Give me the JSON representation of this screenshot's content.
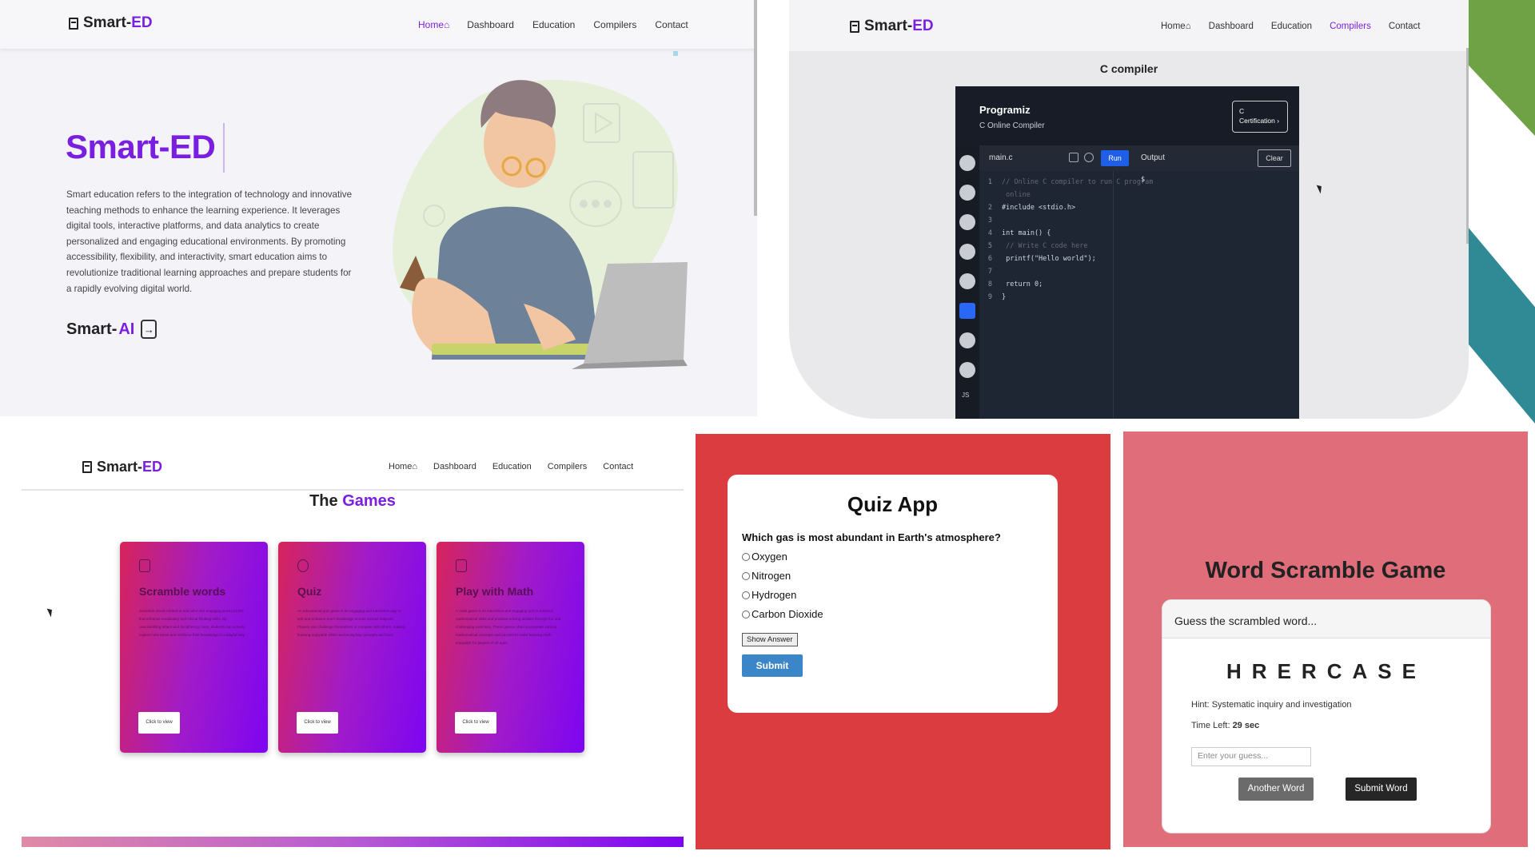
{
  "home": {
    "brand": {
      "left": "Smart-",
      "right": "ED"
    },
    "nav": [
      "Home",
      "Dashboard",
      "Education",
      "Compilers",
      "Contact"
    ],
    "hero_title": "Smart-ED",
    "description": "Smart education refers to the integration of technology and innovative teaching methods to enhance the learning experience. It leverages digital tools, interactive platforms, and data analytics to create personalized and engaging educational environments. By promoting accessibility, flexibility, and interactivity, smart education aims to revolutionize traditional learning approaches and prepare students for a rapidly evolving digital world.",
    "smart_ai": {
      "left": "Smart-",
      "right": "AI"
    }
  },
  "compiler": {
    "brand": {
      "left": "Smart-",
      "right": "ED"
    },
    "nav": [
      "Home",
      "Dashboard",
      "Education",
      "Compilers",
      "Contact"
    ],
    "active_nav": "Compilers",
    "title": "C compiler",
    "ide_brand": "Programiz",
    "ide_subtitle": "C Online Compiler",
    "cert_button": "C Certification",
    "file_tab": "main.c",
    "run_label": "Run",
    "output_label": "Output",
    "clear_label": "Clear",
    "output_prompt": "$",
    "code_lines": [
      {
        "n": "1",
        "t": "// Online C compiler to run C program"
      },
      {
        "n": "",
        "t": "   online"
      },
      {
        "n": "2",
        "t": "#include <stdio.h>"
      },
      {
        "n": "3",
        "t": ""
      },
      {
        "n": "4",
        "t": "int main() {"
      },
      {
        "n": "5",
        "t": "    // Write C code here"
      },
      {
        "n": "6",
        "t": "    printf(\"Hello world\");"
      },
      {
        "n": "7",
        "t": ""
      },
      {
        "n": "8",
        "t": "    return 0;"
      },
      {
        "n": "9",
        "t": "}"
      }
    ],
    "language_icons": [
      "python-icon",
      "r-icon",
      "sql-icon",
      "html-icon",
      "java-icon",
      "c-icon",
      "cpp-icon",
      "csharp-icon",
      "js-icon"
    ],
    "js_label": "JS"
  },
  "games": {
    "brand": {
      "left": "Smart-",
      "right": "ED"
    },
    "nav": [
      "Home",
      "Dashboard",
      "Education",
      "Compilers",
      "Contact"
    ],
    "title_left": "The",
    "title_right": "Games",
    "cards": [
      {
        "title": "Scramble words",
        "text": "Scramble words related to education are engaging word puzzles that enhance vocabulary and critical thinking skills. By unscrambling letters and deciphering clues, students can actively explore new terms and reinforce their knowledge in a playful way.",
        "button": "Click to view",
        "icon": "pencil-icon"
      },
      {
        "title": "Quiz",
        "text": "An educational quiz game is an engaging and interactive way to test and enhance one's knowledge across various subjects. Players can challenge themselves or compete with others, making learning enjoyable while reinforcing key concepts and facts.",
        "button": "Click to view",
        "icon": "question-icon"
      },
      {
        "title": "Play with Math",
        "text": "A math game is an interactive and engaging tool to enhance mathematical skills and problem-solving abilities through fun and challenging exercises. These games often incorporate various mathematical concepts and puzzles to make learning math enjoyable for players of all ages.",
        "button": "Click to view",
        "icon": "gamepad-icon"
      }
    ]
  },
  "quiz": {
    "title": "Quiz App",
    "question": "Which gas is most abundant in Earth's atmosphere?",
    "options": [
      "Oxygen",
      "Nitrogen",
      "Hydrogen",
      "Carbon Dioxide"
    ],
    "show_answer": "Show Answer",
    "submit": "Submit"
  },
  "scramble": {
    "title": "Word Scramble Game",
    "header": "Guess the scrambled word...",
    "scrambled": "HRERCASE",
    "hint_label": "Hint:",
    "hint": "Systematic inquiry and investigation",
    "time_label": "Time Left:",
    "time_value": "29 sec",
    "placeholder": "Enter your guess...",
    "another": "Another Word",
    "submit": "Submit Word"
  },
  "colors": {
    "brand": "#7a1fe0",
    "quiz_bg": "#da3c3f",
    "scramble_bg": "#e06d7a",
    "run_btn": "#1f5fe8"
  }
}
